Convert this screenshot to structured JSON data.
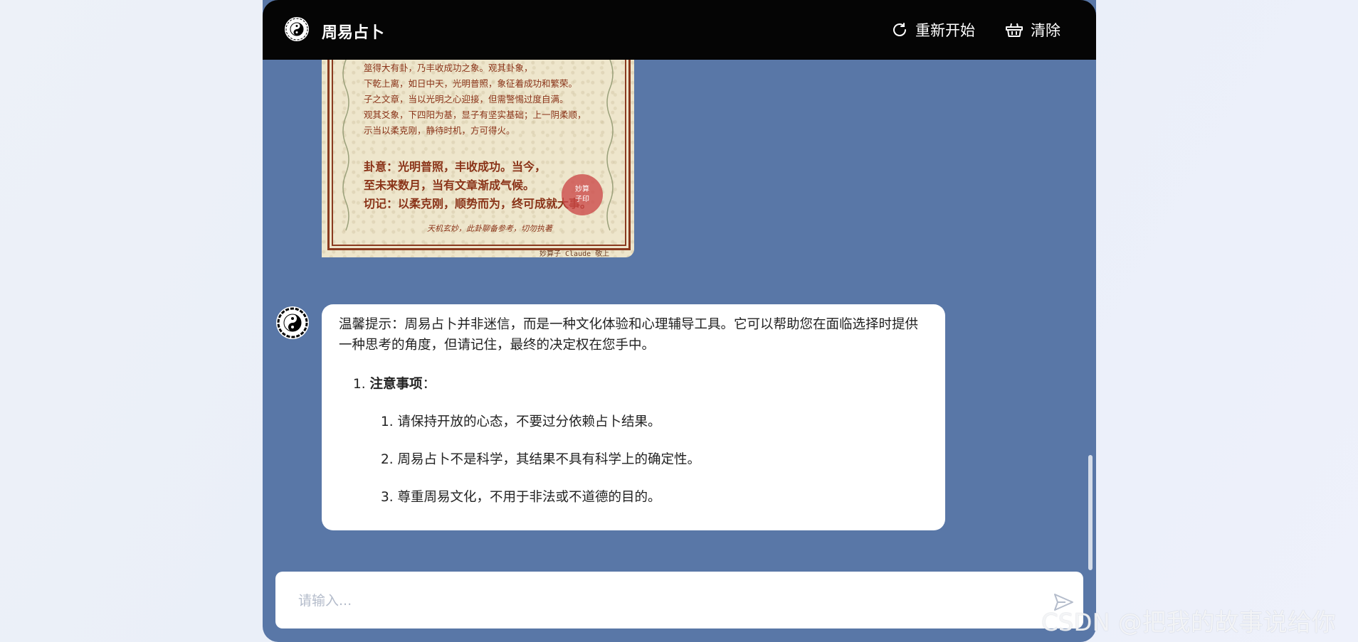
{
  "header": {
    "title": "周易占卜",
    "restart_label": "重新开始",
    "clear_label": "清除",
    "logo_icon": "taiji-bagua-icon"
  },
  "paper_image": {
    "lines": [
      "筮得大有卦，乃丰收成功之象。观其卦象，",
      "下乾上离，如日中天，光明普照，象征着成功和繁荣。",
      "子之文章，当以光明之心迎接，但需警惕过度自满。",
      "观其爻象，下四阳为基，显子有坚实基础；上一阴柔顺，",
      "示当以柔克刚，静待时机，方可得火。"
    ],
    "bold_lines": [
      "卦意：光明普照，丰收成功。当今，",
      "至未来数月，当有文章渐成气候。",
      "切记：以柔克刚，顺势而为，终可成就大事。"
    ],
    "footer": "天机玄妙，此卦聊备参考，切勿执著",
    "signature": "妙算子 Claude 敬上",
    "seal": [
      "妙算",
      "子印"
    ]
  },
  "message": {
    "intro": "温馨提示：周易占卜并非迷信，而是一种文化体验和心理辅导工具。它可以帮助您在面临选择时提供一种思考的角度，但请记住，最终的决定权在您手中。",
    "heading_number": "1.",
    "heading": "注意事项",
    "heading_suffix": "：",
    "items": [
      "1. 请保持开放的心态，不要过分依赖占卜结果。",
      "2. 周易占卜不是科学，其结果不具有科学上的确定性。",
      "3. 尊重周易文化，不用于非法或不道德的目的。"
    ]
  },
  "input": {
    "placeholder": "请输入..."
  },
  "watermark": "CSDN @把我的故事说给你",
  "colors": {
    "chat_bg": "#5977a7",
    "topbar_bg": "#050505",
    "page_bg": "#edf1f8"
  }
}
